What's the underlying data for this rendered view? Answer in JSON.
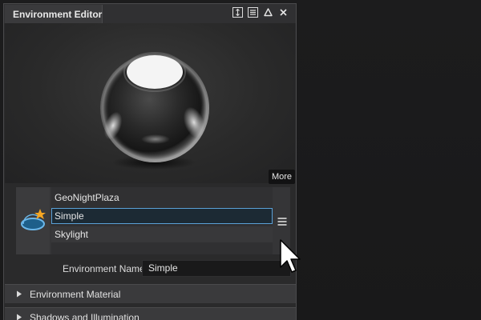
{
  "panel": {
    "title": "Environment Editor",
    "titlebar_icons": [
      "resize-icon",
      "menu-icon",
      "maximize-icon",
      "close-icon"
    ]
  },
  "preview": {
    "more_label": "More"
  },
  "environments": {
    "items": [
      "GeoNightPlaza",
      "Simple",
      "Skylight"
    ],
    "selected": "Simple",
    "accent_color": "#5aa0d6",
    "thumbnail_icon": "environment-star-icon",
    "menu_icon": "list-menu-icon"
  },
  "environment_name": {
    "label": "Environment Name",
    "value": "Simple"
  },
  "sections": [
    {
      "label": "Environment Material"
    },
    {
      "label": "Shadows and Illumination"
    }
  ]
}
